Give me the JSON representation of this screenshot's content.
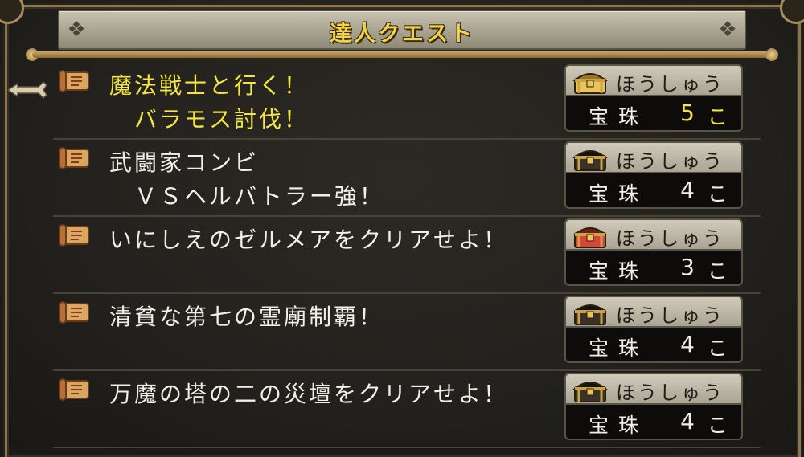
{
  "window": {
    "title": "達人クエスト"
  },
  "quests": [
    {
      "title": "魔法戦士と行く！\n　バラモス討伐！",
      "selected": true,
      "reward": {
        "label": "ほうしゅう",
        "item": "宝珠",
        "count": "5",
        "unit": "こ",
        "chest": "gold-treasure-chest-icon"
      }
    },
    {
      "title": "武闘家コンビ\n　ＶＳヘルバトラー強！",
      "selected": false,
      "reward": {
        "label": "ほうしゅう",
        "item": "宝珠",
        "count": "4",
        "unit": "こ",
        "chest": "black-treasure-chest-icon"
      }
    },
    {
      "title": "いにしえのゼルメアをクリアせよ！",
      "selected": false,
      "reward": {
        "label": "ほうしゅう",
        "item": "宝珠",
        "count": "3",
        "unit": "こ",
        "chest": "red-treasure-chest-icon"
      }
    },
    {
      "title": "清貧な第七の霊廟制覇！",
      "selected": false,
      "reward": {
        "label": "ほうしゅう",
        "item": "宝珠",
        "count": "4",
        "unit": "こ",
        "chest": "black-treasure-chest-icon"
      }
    },
    {
      "title": "万魔の塔の二の災壇をクリアせよ！",
      "selected": false,
      "reward": {
        "label": "ほうしゅう",
        "item": "宝珠",
        "count": "4",
        "unit": "こ",
        "chest": "black-treasure-chest-icon"
      }
    }
  ],
  "colors": {
    "title_gold": "#f2d24a",
    "selected_text": "#f3e640",
    "normal_text": "#f2efe6",
    "chest_gold": "#d9b34a",
    "chest_black": "#2a241c",
    "chest_red": "#c0342a"
  }
}
